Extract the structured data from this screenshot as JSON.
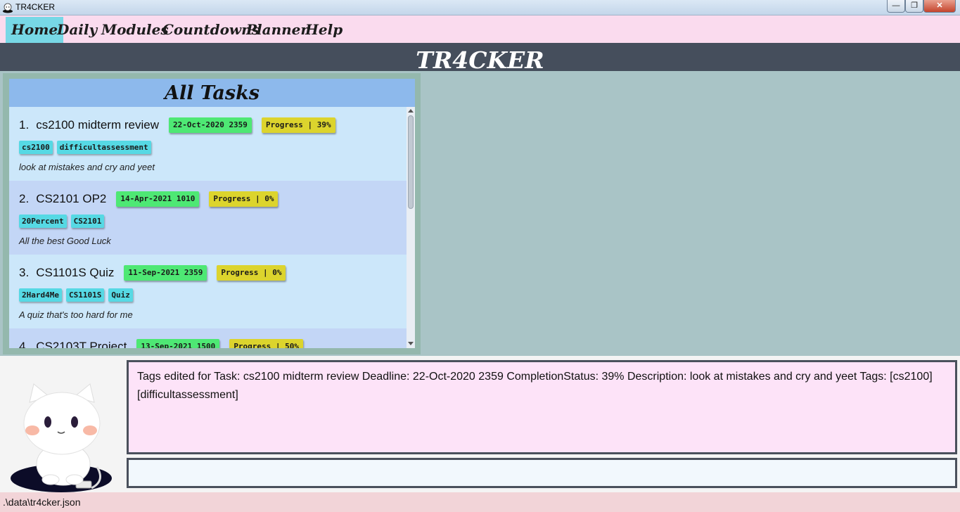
{
  "window": {
    "title": "TR4CKER",
    "controls": {
      "minimize_icon": "minimize-icon",
      "maximize_icon": "maximize-icon",
      "close_icon": "close-icon"
    }
  },
  "menu": {
    "items": [
      {
        "label": "Home",
        "active": true
      },
      {
        "label": "Daily",
        "active": false
      },
      {
        "label": "Modules",
        "active": false
      },
      {
        "label": "Countdowns",
        "active": false
      },
      {
        "label": "Planner",
        "active": false
      },
      {
        "label": "Help",
        "active": false
      }
    ]
  },
  "banner": {
    "title": "TR4CKER"
  },
  "task_panel": {
    "header": "All Tasks",
    "tasks": [
      {
        "index": "1.",
        "name": "cs2100 midterm review",
        "deadline": "22-Oct-2020 2359",
        "progress": "Progress | 39%",
        "tags": [
          "cs2100",
          "difficultassessment"
        ],
        "description": "look at mistakes and cry and yeet"
      },
      {
        "index": "2.",
        "name": "CS2101 OP2",
        "deadline": "14-Apr-2021 1010",
        "progress": "Progress | 0%",
        "tags": [
          "20Percent",
          "CS2101"
        ],
        "description": "All the best Good Luck"
      },
      {
        "index": "3.",
        "name": "CS1101S Quiz",
        "deadline": "11-Sep-2021 2359",
        "progress": "Progress | 0%",
        "tags": [
          "2Hard4Me",
          "CS1101S",
          "Quiz"
        ],
        "description": "A quiz that's too hard for me"
      },
      {
        "index": "4.",
        "name": "CS2103T Project",
        "deadline": "13-Sep-2021 1500",
        "progress": "Progress | 50%",
        "tags": [],
        "description": ""
      }
    ]
  },
  "result_display": {
    "text": "Tags edited for Task: cs2100 midterm review Deadline: 22-Oct-2020 2359 CompletionStatus: 39% Description: look at mistakes and cry and yeet Tags: [cs2100][difficultassessment]"
  },
  "command_box": {
    "value": ""
  },
  "status_bar": {
    "path": ".\\data\\tr4cker.json"
  },
  "colors": {
    "menu_bg": "#fadbee",
    "menu_active": "#77d8e6",
    "banner_bg": "#454e5c",
    "deadline_chip": "#4ee874",
    "progress_chip": "#dcd42d",
    "tag_chip": "#56d9e4"
  }
}
